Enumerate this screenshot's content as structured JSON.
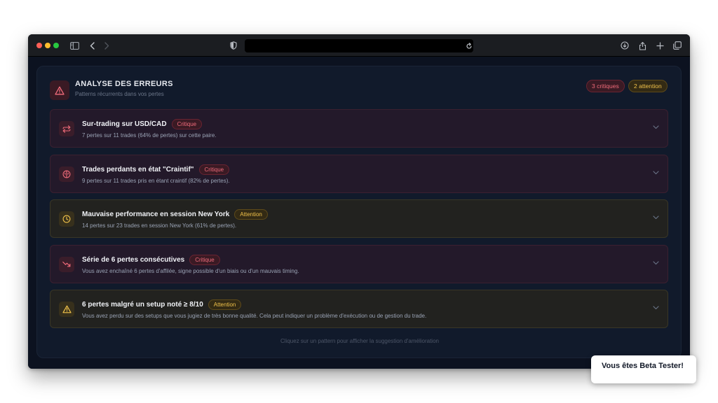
{
  "colors": {
    "critique": "#f06b7a",
    "attention": "#f1c24a",
    "panel_bg": "#111a2b"
  },
  "header": {
    "icon": "alert-triangle-icon",
    "title": "ANALYSE DES ERREURS",
    "subtitle": "Patterns récurrents dans vos pertes",
    "badge_critical": "3 critiques",
    "badge_attention": "2 attention"
  },
  "patterns": [
    {
      "icon": "swap-arrows-icon",
      "title": "Sur-trading sur USD/CAD",
      "severity": "critique",
      "severity_label": "Critique",
      "description": "7 pertes sur 11 trades (64% de pertes) sur cette paire."
    },
    {
      "icon": "brain-icon",
      "title": "Trades perdants en état \"Craintif\"",
      "severity": "critique",
      "severity_label": "Critique",
      "description": "9 pertes sur 11 trades pris en étant craintif (82% de pertes)."
    },
    {
      "icon": "clock-icon",
      "title": "Mauvaise performance en session New York",
      "severity": "attention",
      "severity_label": "Attention",
      "description": "14 pertes sur 23 trades en session New York (61% de pertes)."
    },
    {
      "icon": "trending-down-icon",
      "title": "Série de 6 pertes consécutives",
      "severity": "critique",
      "severity_label": "Critique",
      "description": "Vous avez enchaîné 6 pertes d'affilée, signe possible d'un biais ou d'un mauvais timing."
    },
    {
      "icon": "warning-triangle-icon",
      "title": "6 pertes malgré un setup noté ≥ 8/10",
      "severity": "attention",
      "severity_label": "Attention",
      "description": "Vous avez perdu sur des setups que vous jugiez de très bonne qualité. Cela peut indiquer un problème d'exécution ou de gestion du trade."
    }
  ],
  "footer_hint": "Cliquez sur un pattern pour afficher la suggestion d'amélioration",
  "toast": {
    "text": "Vous êtes Beta Tester!"
  }
}
